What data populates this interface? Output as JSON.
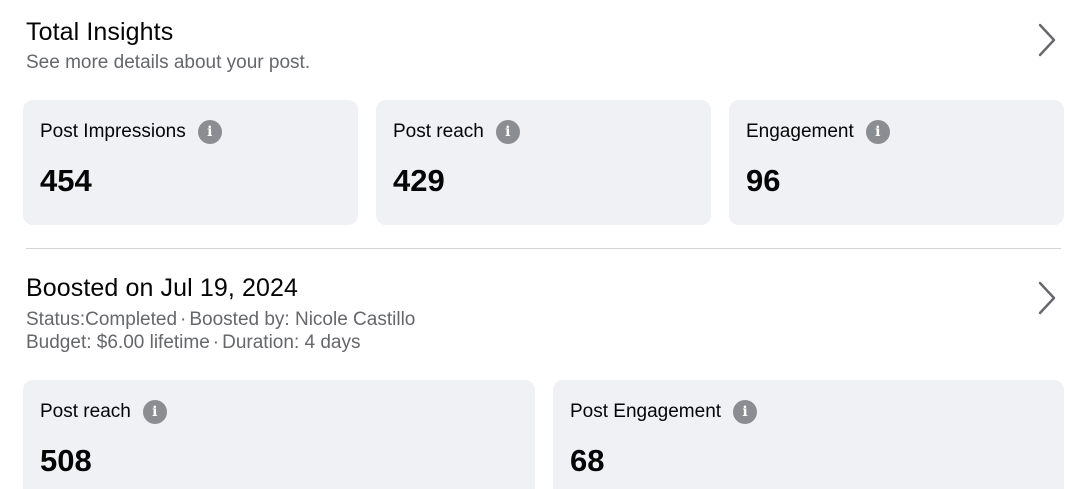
{
  "total_insights": {
    "title": "Total Insights",
    "subtitle": "See more details about your post.",
    "cards": [
      {
        "label": "Post Impressions",
        "value": "454"
      },
      {
        "label": "Post reach",
        "value": "429"
      },
      {
        "label": "Engagement",
        "value": "96"
      }
    ]
  },
  "boost": {
    "title": "Boosted on Jul 19, 2024",
    "status": "Status:Completed",
    "boosted_by": "Boosted by: Nicole Castillo",
    "budget": "Budget: $6.00 lifetime",
    "duration": "Duration: 4 days",
    "separator": "·",
    "cards": [
      {
        "label": "Post reach",
        "value": "508"
      },
      {
        "label": "Post Engagement",
        "value": "68"
      }
    ]
  },
  "icons": {
    "info": "info-icon",
    "chevron": "chevron-right-icon",
    "info_glyph": "i"
  }
}
